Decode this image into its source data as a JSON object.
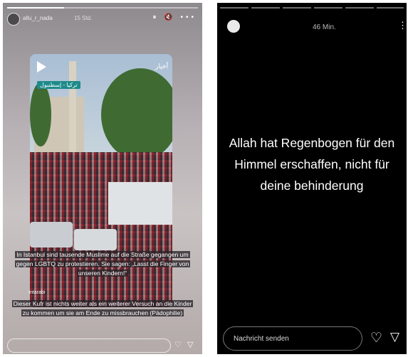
{
  "left_story": {
    "username": "allu_r_nada",
    "time": "15 Std.",
    "header_icons": "⏸ 🔇 •••",
    "progress": 0.3,
    "video": {
      "badge": "تركيا - إسطنبول",
      "logo": "أخبار"
    },
    "watermark": "Intarabi",
    "caption1": "In Istanbul sind tausende Muslime auf die Straße gegangen um gegen LGBTQ zu protestieren. Sie sagen: „Lasst die Finger von unseren Kindern!“",
    "caption2": "Dieser Kufr ist nichts weiter als ein weiterer Versuch an die Kinder zu kommen um sie am Ende zu missbrauchen (Pädophilie)"
  },
  "right_story": {
    "time": "46 Min.",
    "more": "⋮",
    "message": "Allah hat Regenbogen für den Himmel erschaffen, nicht für deine behinderung",
    "reply_placeholder": "Nachricht senden"
  },
  "icons": {
    "heart": "heart-icon",
    "send": "send-icon",
    "play": "play-icon"
  }
}
